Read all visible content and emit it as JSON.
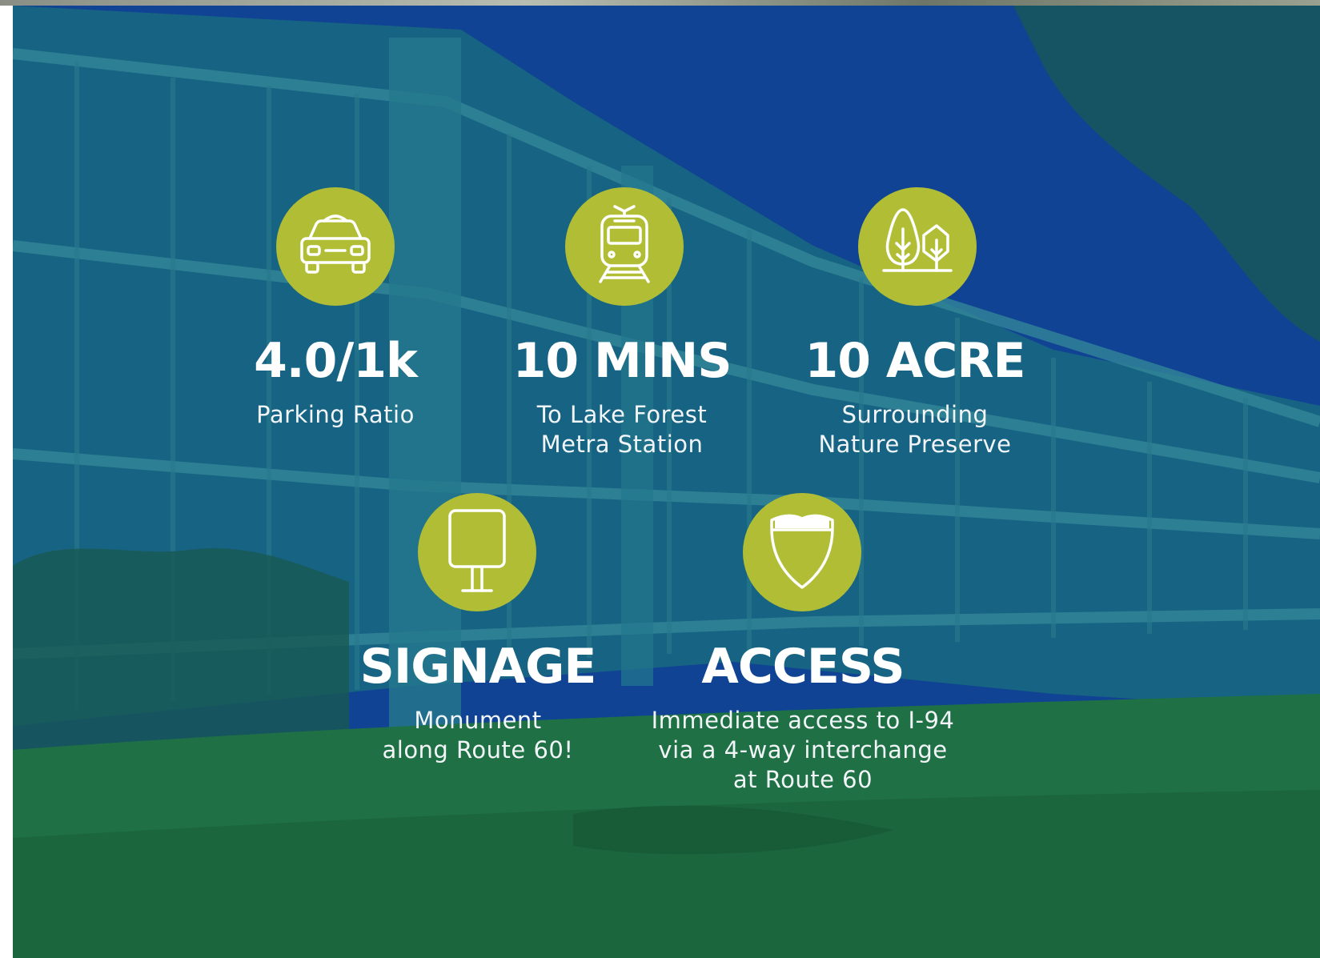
{
  "colors": {
    "badge": "#b1be35",
    "text": "#ffffff",
    "overlay": "#134a8f"
  },
  "background": {
    "subject": "office-building-photo"
  },
  "features": [
    {
      "icon": "car-icon",
      "stat": "4.0/1k",
      "description": "Parking Ratio"
    },
    {
      "icon": "train-icon",
      "stat": "10 MINS",
      "description": "To Lake Forest\nMetra Station"
    },
    {
      "icon": "trees-icon",
      "stat": "10 ACRE",
      "description": "Surrounding\nNature Preserve"
    },
    {
      "icon": "sign-icon",
      "stat": "SIGNAGE",
      "description": "Monument\nalong Route 60!"
    },
    {
      "icon": "highway-shield-icon",
      "stat": "ACCESS",
      "description": "Immediate access to I-94\nvia a 4-way interchange\nat Route 60"
    }
  ]
}
